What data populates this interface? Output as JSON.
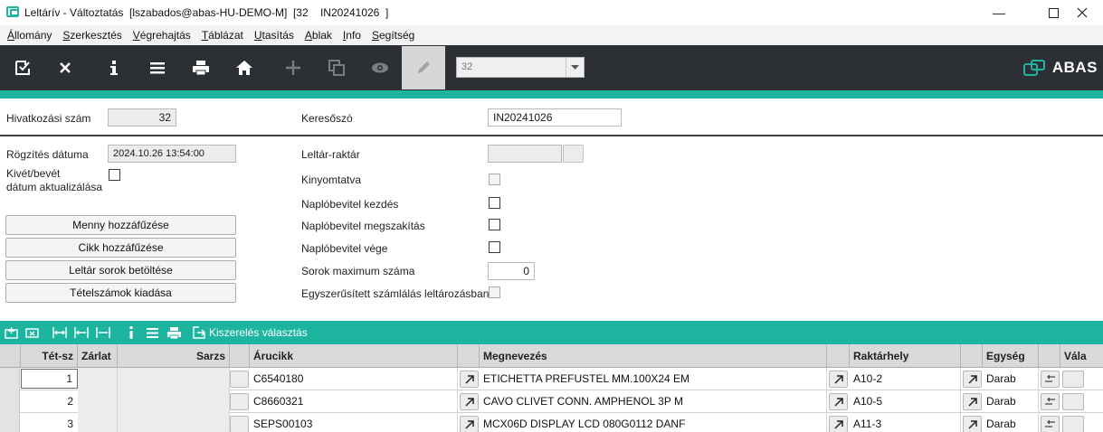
{
  "window": {
    "title": "Leltárív - Változtatás  [lszabados@abas-HU-DEMO-M]  [32    IN20241026  ]",
    "minimize_glyph": "—",
    "maximize_glyph": "☐",
    "close_glyph": "✕"
  },
  "menu": {
    "items": [
      {
        "label": "Állomány"
      },
      {
        "label": "Szerkesztés"
      },
      {
        "label": "Végrehajtás"
      },
      {
        "label": "Táblázat"
      },
      {
        "label": "Utasítás"
      },
      {
        "label": "Ablak"
      },
      {
        "label": "Info"
      },
      {
        "label": "Segítség"
      }
    ]
  },
  "toolbar": {
    "icons": [
      "save-check-icon",
      "close-icon",
      "info-icon",
      "list-menu-icon",
      "print-icon",
      "home-icon",
      "add-icon",
      "copy-icon",
      "view-eye-icon",
      "edit-pencil-icon"
    ],
    "selector_value": "32",
    "logo_text": "ABAS",
    "accent_color": "#1db5a0",
    "dark_color": "#2c2f33"
  },
  "form": {
    "reference_label": "Hivatkozási szám",
    "reference_value": "32",
    "keyword_label": "Keresőszó",
    "keyword_value": "IN20241026",
    "recorded_date_label": "Rögzítés dátuma",
    "recorded_date_value": "2024.10.26 13:54:00",
    "update_in_out_label_1": "Kivét/bevét",
    "update_in_out_label_2": "dátum aktualizálása",
    "update_in_out_checked": false,
    "warehouse_label": "Leltár-raktár",
    "warehouse_value": "",
    "printed_label": "Kinyomtatva",
    "printed_checked": false,
    "log_start_label": "Naplóbevitel kezdés",
    "log_start_checked": false,
    "log_interrupt_label": "Naplóbevitel megszakítás",
    "log_interrupt_checked": false,
    "log_end_label": "Naplóbevitel vége",
    "log_end_checked": false,
    "max_rows_label": "Sorok maximum száma",
    "max_rows_value": "0",
    "simplified_label": "Egyszerűsített számlálás leltározásban",
    "simplified_checked": false
  },
  "actions": {
    "append_qty": "Menny hozzáfűzése",
    "append_item": "Cikk hozzáfűzése",
    "load_rows": "Leltár sorok betöltése",
    "issue_numbers": "Tételszámok kiadása"
  },
  "table_toolbar": {
    "packaging_label": "Kiszerelés választás"
  },
  "table": {
    "headers": {
      "item_no": "Tét-sz",
      "lock": "Zárlat",
      "batch": "Sarzs",
      "article": "Árucikk",
      "name": "Megnevezés",
      "location": "Raktárhely",
      "unit": "Egység",
      "select": "Vála"
    },
    "rows": [
      {
        "num": "1",
        "article": "C6540180",
        "name": "ETICHETTA PREFUSTEL MM.100X24 EM",
        "location": "A10-2",
        "unit": "Darab"
      },
      {
        "num": "2",
        "article": "C8660321",
        "name": "CAVO CLIVET CONN. AMPHENOL  3P M",
        "location": "A10-5",
        "unit": "Darab"
      },
      {
        "num": "3",
        "article": "SEPS00103",
        "name": "MCX06D DISPLAY LCD 080G0112 DANF",
        "location": "A11-3",
        "unit": "Darab"
      }
    ]
  }
}
